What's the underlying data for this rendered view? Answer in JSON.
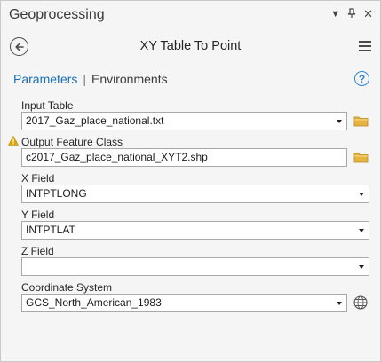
{
  "pane": {
    "title": "Geoprocessing",
    "icons": [
      "dropdown-icon",
      "pin-icon",
      "close-icon"
    ]
  },
  "header": {
    "tool_title": "XY Table To Point"
  },
  "tabs": {
    "active": "Parameters",
    "separator": "|",
    "inactive": "Environments"
  },
  "fields": {
    "input_table": {
      "label": "Input Table",
      "value": "2017_Gaz_place_national.txt"
    },
    "output_feature_class": {
      "label": "Output Feature Class",
      "value": "c2017_Gaz_place_national_XYT2.shp",
      "warning": true
    },
    "x_field": {
      "label": "X Field",
      "value": "INTPTLONG"
    },
    "y_field": {
      "label": "Y Field",
      "value": "INTPTLAT"
    },
    "z_field": {
      "label": "Z Field",
      "value": ""
    },
    "coordinate_system": {
      "label": "Coordinate System",
      "value": "GCS_North_American_1983"
    }
  },
  "colors": {
    "accent": "#1a6fb8",
    "help": "#2f86d6",
    "folder": "#e6b340",
    "warning": "#e0a800"
  }
}
